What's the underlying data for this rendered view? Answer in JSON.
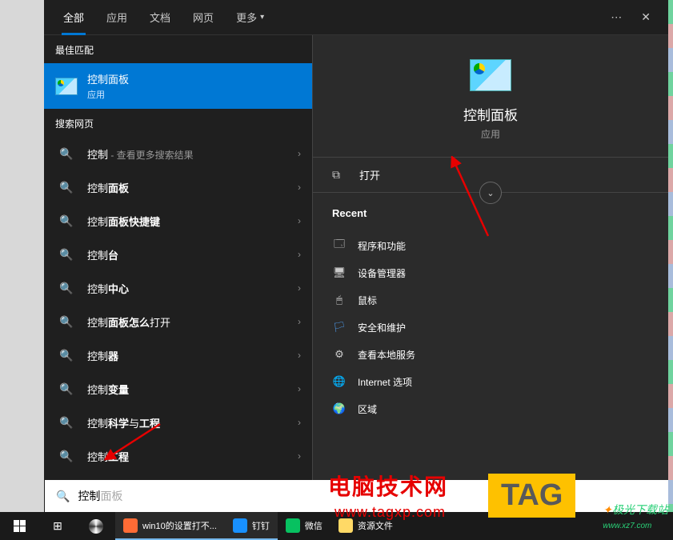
{
  "tabs": {
    "all": "全部",
    "apps": "应用",
    "docs": "文档",
    "web": "网页",
    "more": "更多"
  },
  "sections": {
    "bestMatch": "最佳匹配",
    "searchWeb": "搜索网页"
  },
  "bestMatch": {
    "title": "控制面板",
    "subtitle": "应用"
  },
  "webResults": [
    {
      "prefix": "控制",
      "suffix": " - 查看更多搜索结果"
    },
    {
      "text": "控制面板"
    },
    {
      "text": "控制面板快捷键"
    },
    {
      "text": "控制台"
    },
    {
      "text": "控制中心"
    },
    {
      "text": "控制面板怎么打开"
    },
    {
      "text": "控制器"
    },
    {
      "text": "控制变量"
    },
    {
      "text": "控制科学与工程"
    },
    {
      "text": "控制工程"
    }
  ],
  "preview": {
    "title": "控制面板",
    "subtitle": "应用",
    "open": "打开",
    "recentLabel": "Recent"
  },
  "recent": [
    {
      "icon": "🗔",
      "label": "程序和功能"
    },
    {
      "icon": "🖥",
      "label": "设备管理器"
    },
    {
      "icon": "🖱",
      "label": "鼠标"
    },
    {
      "icon": "🏳",
      "label": "安全和维护",
      "color": "#4a90d9"
    },
    {
      "icon": "⚙",
      "label": "查看本地服务"
    },
    {
      "icon": "🌐",
      "label": "Internet 选项"
    },
    {
      "icon": "🌍",
      "label": "区域"
    }
  ],
  "searchBox": {
    "typed": "控制",
    "ghost": "面板"
  },
  "taskbar": {
    "items": [
      {
        "label": "win10的设置打不...",
        "color": "#ff6b35"
      },
      {
        "label": "钉钉",
        "color": "#1890ff"
      },
      {
        "label": "微信",
        "color": "#07c160"
      },
      {
        "label": "资源文件",
        "color": "#ffd966"
      }
    ]
  },
  "watermark": {
    "text": "电脑技术网",
    "url": "www.tagxp.com",
    "tag": "TAG",
    "side1": "极光下载站",
    "side2": "www.xz7.com"
  }
}
